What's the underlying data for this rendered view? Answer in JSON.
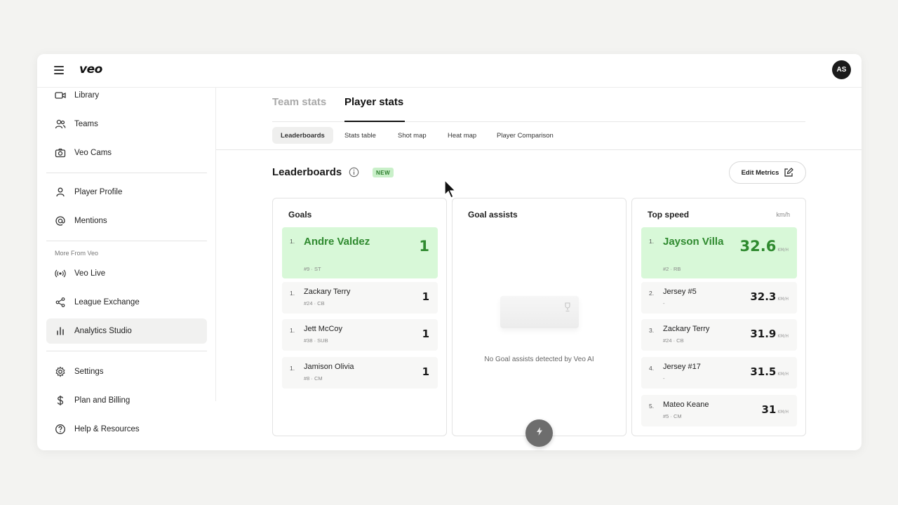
{
  "app": {
    "logo": "veo",
    "avatar_initials": "AS"
  },
  "sidebar": {
    "items": [
      {
        "label": "Library",
        "icon": "video-camera-icon"
      },
      {
        "label": "Teams",
        "icon": "users-icon"
      },
      {
        "label": "Veo Cams",
        "icon": "camera-icon"
      },
      {
        "label": "Player Profile",
        "icon": "person-icon"
      },
      {
        "label": "Mentions",
        "icon": "at-sign-icon"
      }
    ],
    "section_label": "More From Veo",
    "more_items": [
      {
        "label": "Veo Live",
        "icon": "broadcast-icon"
      },
      {
        "label": "League Exchange",
        "icon": "share-icon"
      },
      {
        "label": "Analytics Studio",
        "icon": "bar-chart-icon"
      }
    ],
    "bottom_items": [
      {
        "label": "Settings",
        "icon": "gear-icon"
      },
      {
        "label": "Plan and Billing",
        "icon": "dollar-icon"
      },
      {
        "label": "Help & Resources",
        "icon": "help-circle-icon"
      }
    ]
  },
  "tabs": {
    "team": "Team stats",
    "player": "Player stats"
  },
  "subtabs": [
    "Leaderboards",
    "Stats table",
    "Shot map",
    "Heat map",
    "Player Comparison"
  ],
  "leaderboards": {
    "title": "Leaderboards",
    "badge": "NEW",
    "edit_button": "Edit Metrics"
  },
  "cards": {
    "goals": {
      "title": "Goals",
      "rows": [
        {
          "rank": "1.",
          "name": "Andre Valdez",
          "sub": "#9 · ST",
          "value": "1"
        },
        {
          "rank": "1.",
          "name": "Zackary Terry",
          "sub": "#24 · CB",
          "value": "1"
        },
        {
          "rank": "1.",
          "name": "Jett McCoy",
          "sub": "#38 · SUB",
          "value": "1"
        },
        {
          "rank": "1.",
          "name": "Jamison Olivia",
          "sub": "#8 · CM",
          "value": "1"
        }
      ]
    },
    "assists": {
      "title": "Goal assists",
      "empty_text": "No Goal assists detected by Veo AI"
    },
    "speed": {
      "title": "Top speed",
      "unit": "km/h",
      "value_unit": "KM/H",
      "rows": [
        {
          "rank": "1.",
          "name": "Jayson Villa",
          "sub": "#2 · RB",
          "value": "32.6"
        },
        {
          "rank": "2.",
          "name": "Jersey #5",
          "sub": "-",
          "value": "32.3"
        },
        {
          "rank": "3.",
          "name": "Zackary Terry",
          "sub": "#24 · CB",
          "value": "31.9"
        },
        {
          "rank": "4.",
          "name": "Jersey #17",
          "sub": "-",
          "value": "31.5"
        },
        {
          "rank": "5.",
          "name": "Mateo Keane",
          "sub": "#5 · CM",
          "value": "31"
        }
      ]
    }
  },
  "colors": {
    "accent_green": "#2f8a2f",
    "highlight_bg": "#d8f8d8"
  }
}
